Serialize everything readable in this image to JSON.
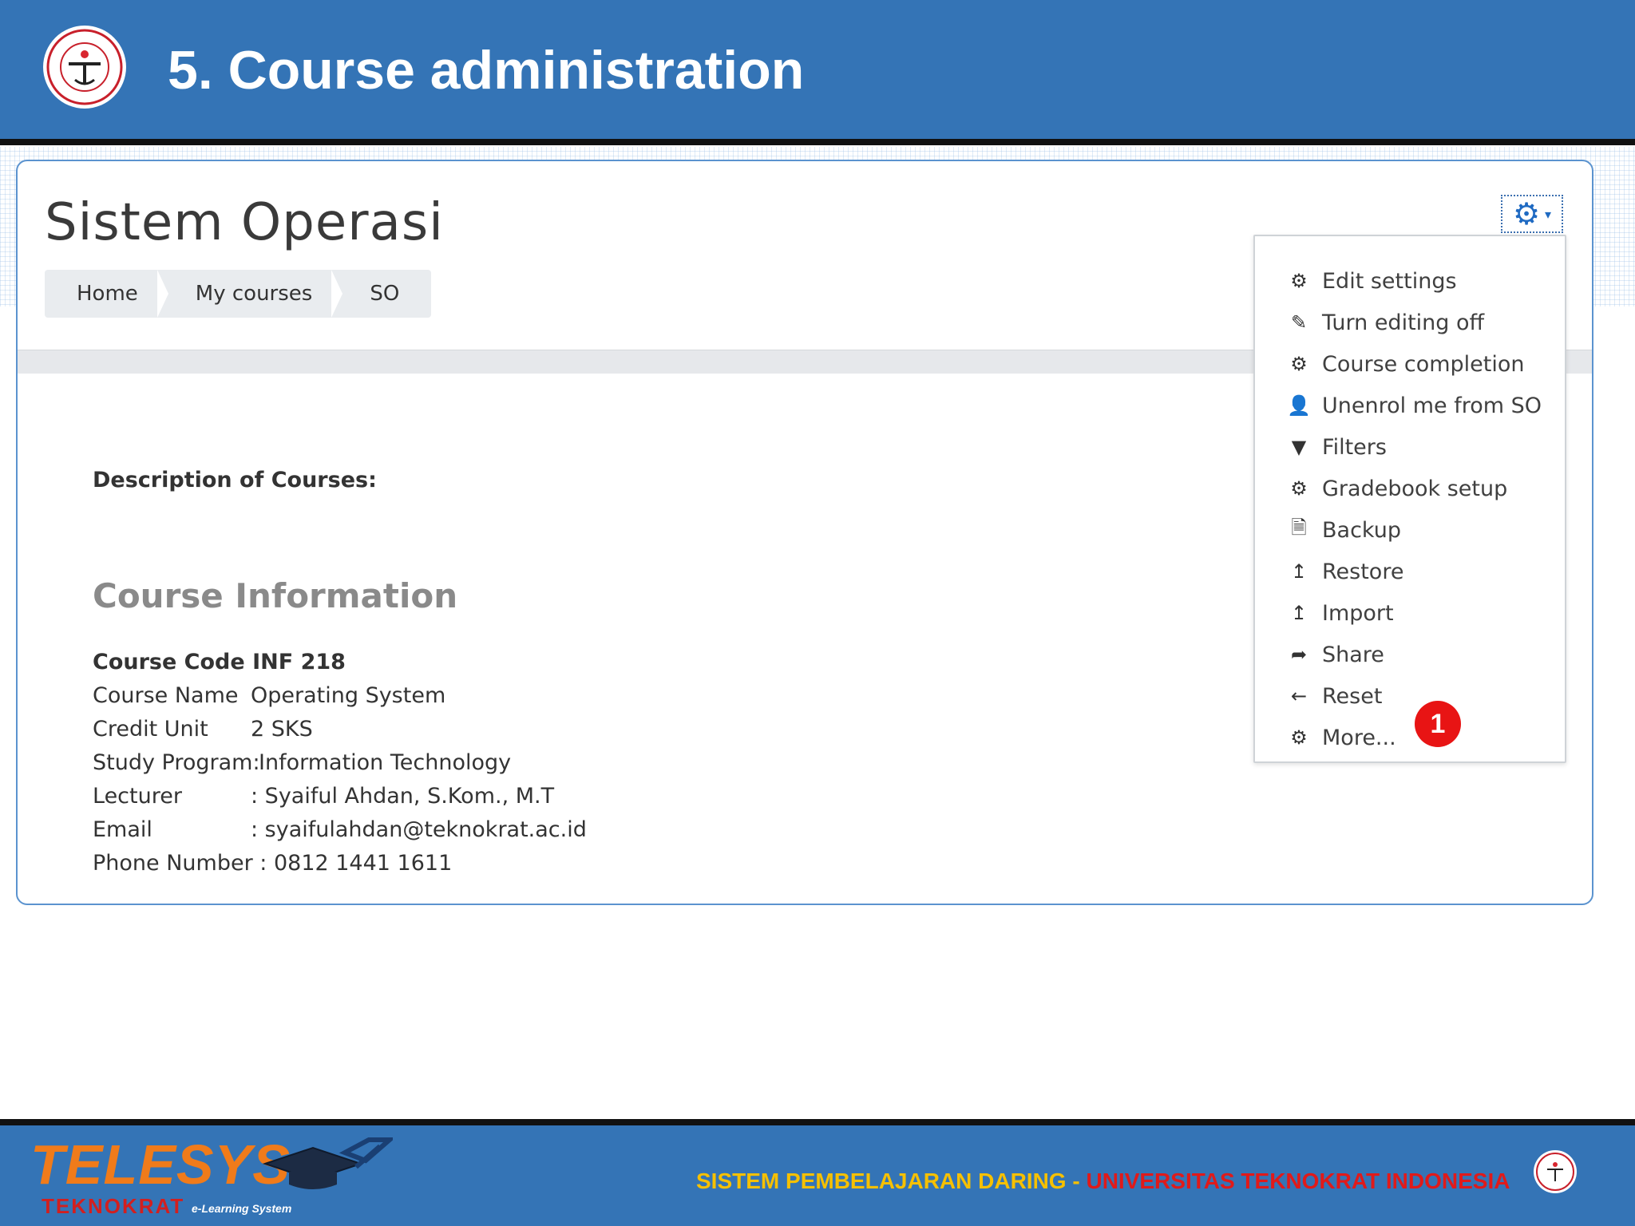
{
  "slide": {
    "title": "5. Course administration"
  },
  "course": {
    "title": "Sistem Operasi",
    "breadcrumb": [
      "Home",
      "My courses",
      "SO"
    ]
  },
  "admin_menu": {
    "items": [
      {
        "label": "Edit settings",
        "icon": "gear-icon"
      },
      {
        "label": "Turn editing off",
        "icon": "pencil-icon"
      },
      {
        "label": "Course completion",
        "icon": "gear-icon"
      },
      {
        "label": "Unenrol me from SO",
        "icon": "user-icon"
      },
      {
        "label": "Filters",
        "icon": "filter-icon"
      },
      {
        "label": "Gradebook setup",
        "icon": "gear-icon"
      },
      {
        "label": "Backup",
        "icon": "file-icon"
      },
      {
        "label": "Restore",
        "icon": "upload-icon"
      },
      {
        "label": "Import",
        "icon": "upload-icon"
      },
      {
        "label": "Share",
        "icon": "share-icon"
      },
      {
        "label": "Reset",
        "icon": "arrow-left-icon"
      },
      {
        "label": "More...",
        "icon": "gear-icon"
      }
    ],
    "step_badge": "1"
  },
  "content": {
    "description_heading": "Description of Courses:",
    "info_heading": "Course Information",
    "rows": [
      {
        "key": "Course Code",
        "value": "INF 218"
      },
      {
        "key": "Course Name",
        "value": "Operating System"
      },
      {
        "key": "Credit Unit",
        "value": "2 SKS"
      },
      {
        "key": "Study Program:",
        "value": "Information Technology"
      },
      {
        "key": "Lecturer",
        "value": ": Syaiful Ahdan, S.Kom., M.T"
      },
      {
        "key": "Email",
        "value": ": syaifulahdan@teknokrat.ac.id"
      },
      {
        "key": "Phone Number",
        "value": ": 0812 1441 1611"
      }
    ]
  },
  "footer": {
    "brand": "TELESYS",
    "brand_sub": "TEKNOKRAT",
    "brand_tag": "e-Learning System",
    "text_part1": "SISTEM PEMBELAJARAN DARING",
    "text_sep": " - ",
    "text_part2": "UNIVERSITAS TEKNOKRAT INDONESIA"
  },
  "colors": {
    "header_blue": "#3474b6",
    "badge_red": "#e81414",
    "footer_yellow": "#f6c000",
    "footer_red": "#e01a1a"
  }
}
